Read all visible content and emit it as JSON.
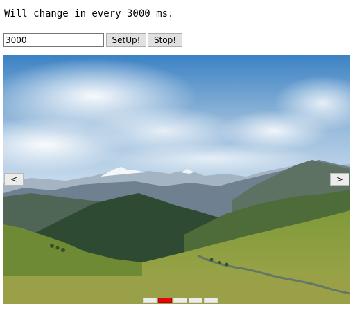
{
  "status_text": "Will change in every 3000 ms.",
  "controls": {
    "interval_value": "3000",
    "setup_label": "SetUp!",
    "stop_label": "Stop!"
  },
  "slider": {
    "prev_label": "<",
    "next_label": ">",
    "slide_count": 5,
    "active_index": 1,
    "image_subject": "alpine-mountain-landscape",
    "colors": {
      "sky_top": "#3b82c4",
      "sky_light": "#cfe0ef",
      "snow": "#f4f6f8",
      "distant_range": "#6f8191",
      "forest_dark": "#2f4a33",
      "meadow": "#93a444",
      "dot_active": "#e8060c",
      "dot_inactive": "#ececec"
    }
  }
}
